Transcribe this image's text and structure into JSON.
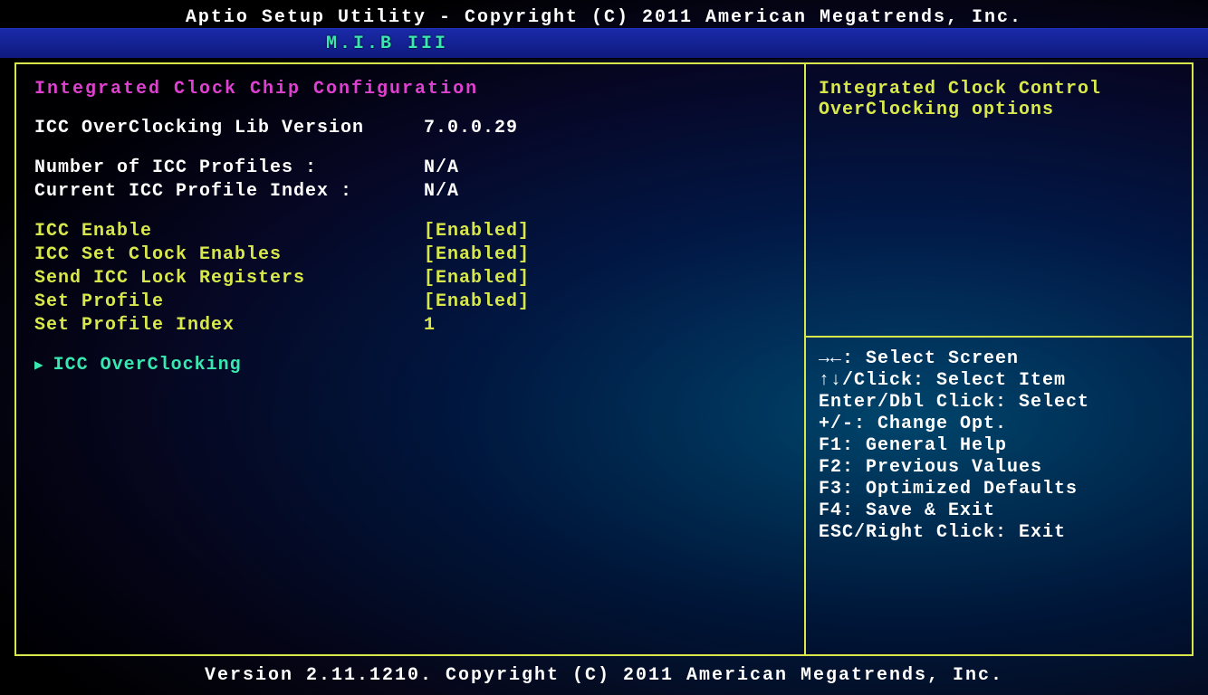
{
  "header": {
    "title": "Aptio Setup Utility - Copyright (C) 2011 American Megatrends, Inc.",
    "active_tab": "M.I.B III"
  },
  "main": {
    "section_title": "Integrated Clock Chip Configuration",
    "info_rows": [
      {
        "label": "ICC OverClocking Lib Version",
        "value": "7.0.0.29"
      }
    ],
    "profile_rows": [
      {
        "label": "Number of ICC Profiles :",
        "value": "N/A"
      },
      {
        "label": "Current ICC Profile Index :",
        "value": "N/A"
      }
    ],
    "option_rows": [
      {
        "label": "ICC Enable",
        "value": "[Enabled]"
      },
      {
        "label": "ICC Set Clock Enables",
        "value": "[Enabled]"
      },
      {
        "label": "Send ICC Lock Registers",
        "value": "[Enabled]"
      },
      {
        "label": "Set Profile",
        "value": "[Enabled]"
      },
      {
        "label": "Set Profile Index",
        "value": "1"
      }
    ],
    "submenu": {
      "label": "ICC OverClocking"
    }
  },
  "side": {
    "desc_line1": "Integrated Clock Control",
    "desc_line2": "OverClocking options",
    "help": [
      "→←: Select Screen",
      "↑↓/Click: Select Item",
      "Enter/Dbl Click: Select",
      "+/-: Change Opt.",
      "F1: General Help",
      "F2: Previous Values",
      "F3: Optimized Defaults",
      "F4: Save & Exit",
      "ESC/Right Click: Exit"
    ]
  },
  "footer": {
    "text": "Version 2.11.1210. Copyright (C) 2011 American Megatrends, Inc."
  }
}
